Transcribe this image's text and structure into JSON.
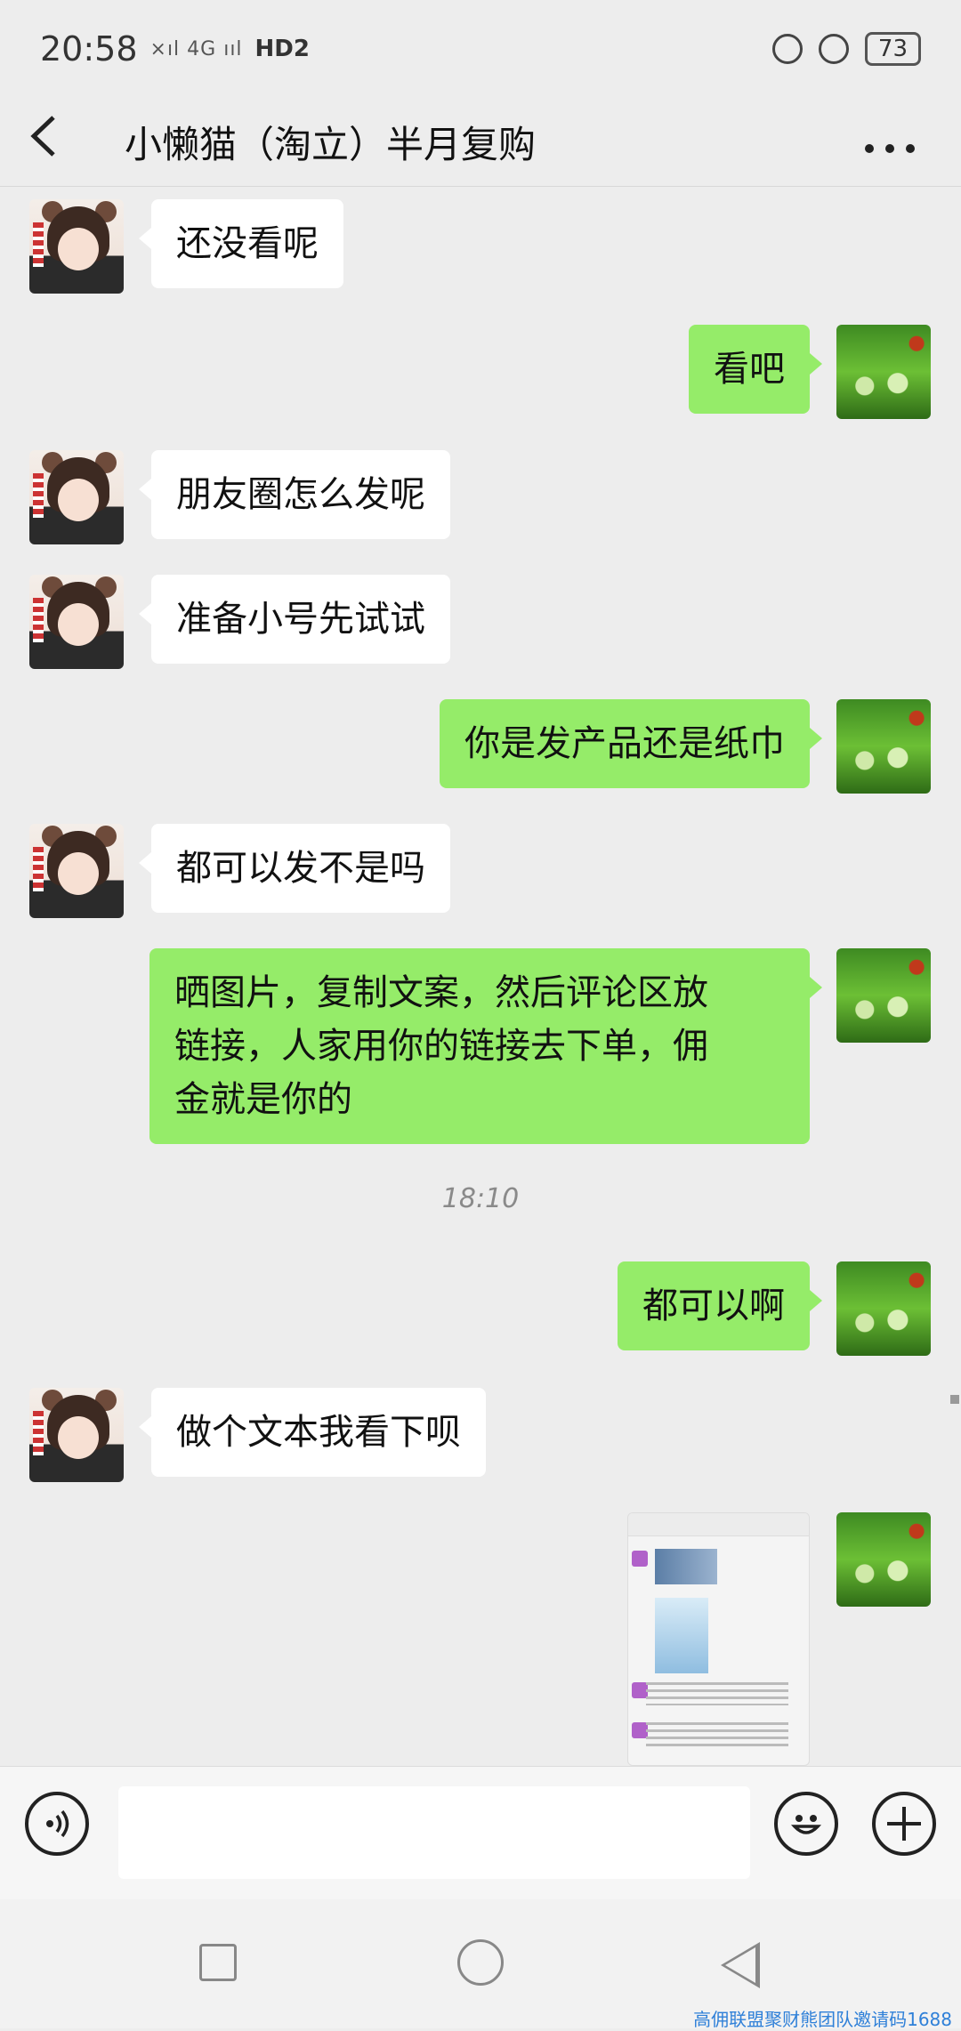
{
  "status_bar": {
    "time": "20:58",
    "signal": "×ıl 4G ııl",
    "hd": "HD2",
    "battery": "73"
  },
  "header": {
    "title": "小懒猫（淘立）半月复购",
    "back_icon": "chevron-left-icon",
    "more_icon": "more-dots-icon"
  },
  "messages": [
    {
      "side": "in",
      "text": "还没看呢"
    },
    {
      "side": "out",
      "text": "看吧"
    },
    {
      "side": "in",
      "text": "朋友圈怎么发呢"
    },
    {
      "side": "in",
      "text": "准备小号先试试"
    },
    {
      "side": "out",
      "text": "你是发产品还是纸巾"
    },
    {
      "side": "in",
      "text": "都可以发不是吗"
    },
    {
      "side": "out",
      "text": "晒图片，复制文案，然后评论区放\n链接，人家用你的链接去下单，佣\n金就是你的"
    },
    {
      "side": "out",
      "text": "都可以啊"
    },
    {
      "side": "in",
      "text": "做个文本我看下呗"
    }
  ],
  "timestamp": "18:10",
  "input_bar": {
    "voice_icon": "voice-icon",
    "emoji_icon": "emoji-icon",
    "plus_icon": "plus-icon"
  },
  "watermark": "高佣联盟聚财熊团队邀请码1688",
  "colors": {
    "outgoing_bubble": "#95ec69",
    "incoming_bubble": "#ffffff",
    "background": "#ededed"
  }
}
